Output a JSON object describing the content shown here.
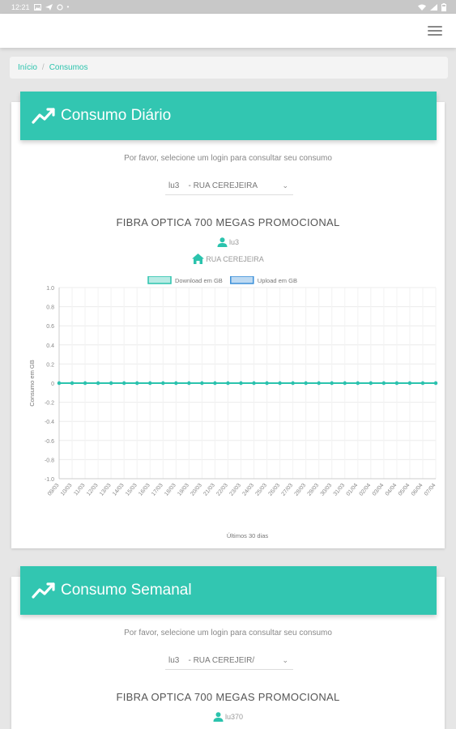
{
  "status_bar": {
    "time": "12:21"
  },
  "breadcrumb": {
    "home": "Início",
    "current": "Consumos"
  },
  "daily": {
    "title": "Consumo Diário",
    "instruction": "Por favor, selecione um login para consultar seu consumo",
    "select_value": "lu3    - RUA CEREJEIRA",
    "plan": "FIBRA OPTICA 700 MEGAS PROMOCIONAL",
    "login": "lu3",
    "address": "RUA CEREJEIRA"
  },
  "weekly": {
    "title": "Consumo Semanal",
    "instruction": "Por favor, selecione um login para consultar seu consumo",
    "select_value": "lu3    - RUA CEREJEIR/",
    "plan": "FIBRA OPTICA 700 MEGAS PROMOCIONAL",
    "login": "lu370"
  },
  "colors": {
    "accent": "#32c6b1",
    "download": "#2bc3ad",
    "upload": "#3b8fd9"
  },
  "chart_data": {
    "type": "line",
    "xlabel": "Últimos 30 dias",
    "ylabel": "Consumo em GB",
    "ylim": [
      -1.0,
      1.0
    ],
    "y_ticks": [
      "1.0",
      "0.8",
      "0.6",
      "0.4",
      "0.2",
      "0",
      "-0.2",
      "-0.4",
      "-0.6",
      "-0.8",
      "-1.0"
    ],
    "categories": [
      "09/03",
      "10/03",
      "11/03",
      "12/03",
      "13/03",
      "14/03",
      "15/03",
      "16/03",
      "17/03",
      "18/03",
      "19/03",
      "20/03",
      "21/03",
      "22/03",
      "23/03",
      "24/03",
      "25/03",
      "26/03",
      "27/03",
      "28/03",
      "29/03",
      "30/03",
      "31/03",
      "01/04",
      "02/04",
      "03/04",
      "04/04",
      "05/04",
      "06/04",
      "07/04"
    ],
    "series": [
      {
        "name": "Download em GB",
        "color": "#2bc3ad",
        "values": [
          0,
          0,
          0,
          0,
          0,
          0,
          0,
          0,
          0,
          0,
          0,
          0,
          0,
          0,
          0,
          0,
          0,
          0,
          0,
          0,
          0,
          0,
          0,
          0,
          0,
          0,
          0,
          0,
          0,
          0
        ]
      },
      {
        "name": "Upload em GB",
        "color": "#3b8fd9",
        "values": [
          0,
          0,
          0,
          0,
          0,
          0,
          0,
          0,
          0,
          0,
          0,
          0,
          0,
          0,
          0,
          0,
          0,
          0,
          0,
          0,
          0,
          0,
          0,
          0,
          0,
          0,
          0,
          0,
          0,
          0
        ]
      }
    ],
    "grid": true,
    "legend": "top"
  }
}
